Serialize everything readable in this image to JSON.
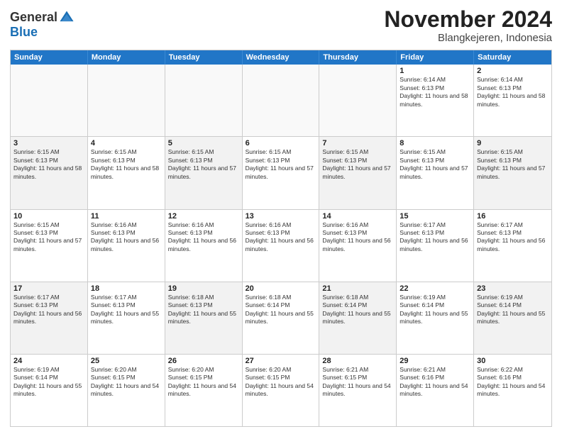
{
  "logo": {
    "general": "General",
    "blue": "Blue"
  },
  "header": {
    "month": "November 2024",
    "location": "Blangkejeren, Indonesia"
  },
  "weekdays": [
    "Sunday",
    "Monday",
    "Tuesday",
    "Wednesday",
    "Thursday",
    "Friday",
    "Saturday"
  ],
  "rows": [
    [
      {
        "day": "",
        "info": ""
      },
      {
        "day": "",
        "info": ""
      },
      {
        "day": "",
        "info": ""
      },
      {
        "day": "",
        "info": ""
      },
      {
        "day": "",
        "info": ""
      },
      {
        "day": "1",
        "info": "Sunrise: 6:14 AM\nSunset: 6:13 PM\nDaylight: 11 hours and 58 minutes."
      },
      {
        "day": "2",
        "info": "Sunrise: 6:14 AM\nSunset: 6:13 PM\nDaylight: 11 hours and 58 minutes."
      }
    ],
    [
      {
        "day": "3",
        "info": "Sunrise: 6:15 AM\nSunset: 6:13 PM\nDaylight: 11 hours and 58 minutes."
      },
      {
        "day": "4",
        "info": "Sunrise: 6:15 AM\nSunset: 6:13 PM\nDaylight: 11 hours and 58 minutes."
      },
      {
        "day": "5",
        "info": "Sunrise: 6:15 AM\nSunset: 6:13 PM\nDaylight: 11 hours and 57 minutes."
      },
      {
        "day": "6",
        "info": "Sunrise: 6:15 AM\nSunset: 6:13 PM\nDaylight: 11 hours and 57 minutes."
      },
      {
        "day": "7",
        "info": "Sunrise: 6:15 AM\nSunset: 6:13 PM\nDaylight: 11 hours and 57 minutes."
      },
      {
        "day": "8",
        "info": "Sunrise: 6:15 AM\nSunset: 6:13 PM\nDaylight: 11 hours and 57 minutes."
      },
      {
        "day": "9",
        "info": "Sunrise: 6:15 AM\nSunset: 6:13 PM\nDaylight: 11 hours and 57 minutes."
      }
    ],
    [
      {
        "day": "10",
        "info": "Sunrise: 6:15 AM\nSunset: 6:13 PM\nDaylight: 11 hours and 57 minutes."
      },
      {
        "day": "11",
        "info": "Sunrise: 6:16 AM\nSunset: 6:13 PM\nDaylight: 11 hours and 56 minutes."
      },
      {
        "day": "12",
        "info": "Sunrise: 6:16 AM\nSunset: 6:13 PM\nDaylight: 11 hours and 56 minutes."
      },
      {
        "day": "13",
        "info": "Sunrise: 6:16 AM\nSunset: 6:13 PM\nDaylight: 11 hours and 56 minutes."
      },
      {
        "day": "14",
        "info": "Sunrise: 6:16 AM\nSunset: 6:13 PM\nDaylight: 11 hours and 56 minutes."
      },
      {
        "day": "15",
        "info": "Sunrise: 6:17 AM\nSunset: 6:13 PM\nDaylight: 11 hours and 56 minutes."
      },
      {
        "day": "16",
        "info": "Sunrise: 6:17 AM\nSunset: 6:13 PM\nDaylight: 11 hours and 56 minutes."
      }
    ],
    [
      {
        "day": "17",
        "info": "Sunrise: 6:17 AM\nSunset: 6:13 PM\nDaylight: 11 hours and 56 minutes."
      },
      {
        "day": "18",
        "info": "Sunrise: 6:17 AM\nSunset: 6:13 PM\nDaylight: 11 hours and 55 minutes."
      },
      {
        "day": "19",
        "info": "Sunrise: 6:18 AM\nSunset: 6:13 PM\nDaylight: 11 hours and 55 minutes."
      },
      {
        "day": "20",
        "info": "Sunrise: 6:18 AM\nSunset: 6:14 PM\nDaylight: 11 hours and 55 minutes."
      },
      {
        "day": "21",
        "info": "Sunrise: 6:18 AM\nSunset: 6:14 PM\nDaylight: 11 hours and 55 minutes."
      },
      {
        "day": "22",
        "info": "Sunrise: 6:19 AM\nSunset: 6:14 PM\nDaylight: 11 hours and 55 minutes."
      },
      {
        "day": "23",
        "info": "Sunrise: 6:19 AM\nSunset: 6:14 PM\nDaylight: 11 hours and 55 minutes."
      }
    ],
    [
      {
        "day": "24",
        "info": "Sunrise: 6:19 AM\nSunset: 6:14 PM\nDaylight: 11 hours and 55 minutes."
      },
      {
        "day": "25",
        "info": "Sunrise: 6:20 AM\nSunset: 6:15 PM\nDaylight: 11 hours and 54 minutes."
      },
      {
        "day": "26",
        "info": "Sunrise: 6:20 AM\nSunset: 6:15 PM\nDaylight: 11 hours and 54 minutes."
      },
      {
        "day": "27",
        "info": "Sunrise: 6:20 AM\nSunset: 6:15 PM\nDaylight: 11 hours and 54 minutes."
      },
      {
        "day": "28",
        "info": "Sunrise: 6:21 AM\nSunset: 6:15 PM\nDaylight: 11 hours and 54 minutes."
      },
      {
        "day": "29",
        "info": "Sunrise: 6:21 AM\nSunset: 6:16 PM\nDaylight: 11 hours and 54 minutes."
      },
      {
        "day": "30",
        "info": "Sunrise: 6:22 AM\nSunset: 6:16 PM\nDaylight: 11 hours and 54 minutes."
      }
    ]
  ]
}
